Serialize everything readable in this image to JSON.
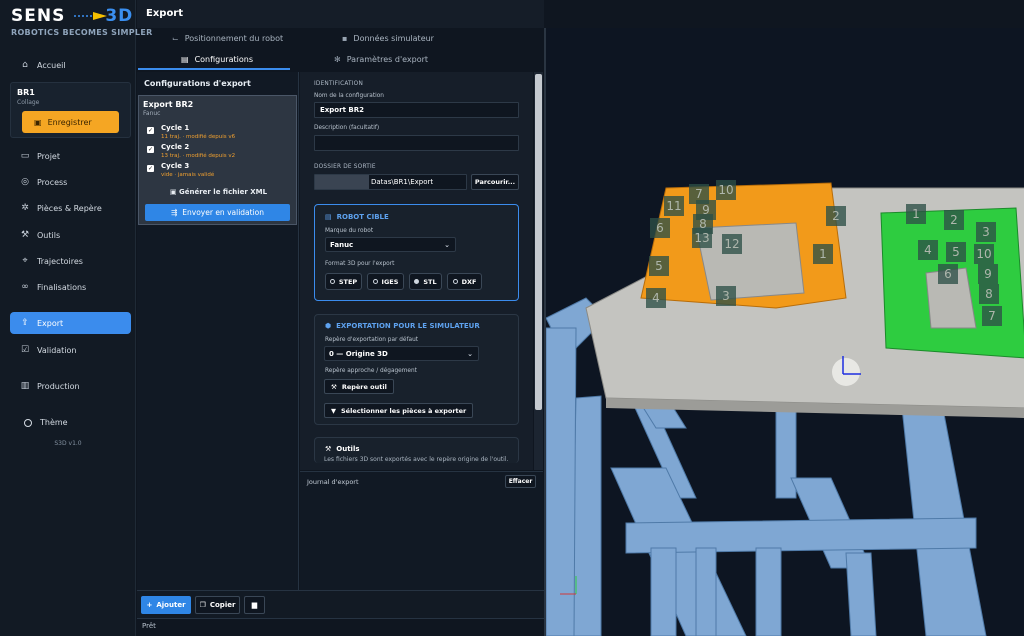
{
  "brand": {
    "word": "SENS",
    "accent": "3D",
    "tagline": "ROBOTICS BECOMES SIMPLER"
  },
  "nav": {
    "home": "Accueil",
    "project_box": {
      "name": "BR1",
      "sub": "Collage",
      "save_label": "Enregistrer"
    },
    "items": [
      {
        "label": "Projet",
        "icon": "folder-icon"
      },
      {
        "label": "Process",
        "icon": "target-icon"
      },
      {
        "label": "Pièces & Repère",
        "icon": "gear-icon"
      },
      {
        "label": "Outils",
        "icon": "wrench-icon"
      },
      {
        "label": "Trajectoires",
        "icon": "location-pin-icon"
      },
      {
        "label": "Finalisations",
        "icon": "link-icon"
      },
      {
        "label": "Export",
        "icon": "export-icon",
        "active": true
      },
      {
        "label": "Validation",
        "icon": "checkbox-icon"
      },
      {
        "label": "Production",
        "icon": "factory-icon"
      }
    ],
    "theme": "Thème",
    "version": "S3D v1.0"
  },
  "header": {
    "title": "Export"
  },
  "tabs": {
    "positioning": "Positionnement du robot",
    "sim_data": "Données simulateur",
    "configs": "Configurations",
    "export_params": "Paramètres d'export"
  },
  "configs_panel": {
    "title": "Configurations d'export",
    "card": {
      "name": "Export BR2",
      "brand": "Fanuc",
      "cycles": [
        {
          "name": "Cycle 1",
          "status": "11 traj. · modifié depuis v6",
          "checked": true
        },
        {
          "name": "Cycle 2",
          "status": "13 traj. · modifié depuis v2",
          "checked": true
        },
        {
          "name": "Cycle 3",
          "status": "vide · jamais validé",
          "checked": true
        }
      ],
      "generate_xml": "Générer le fichier XML",
      "send_validation": "Envoyer en validation"
    }
  },
  "form": {
    "identification_label": "IDENTIFICATION",
    "config_name_label": "Nom de la configuration",
    "config_name_value": "Export BR2",
    "description_label": "Description (facultatif)",
    "description_value": "",
    "output_dir_label": "DOSSIER DE SORTIE",
    "output_dir_value": "Datas\\BR1\\Export",
    "browse_label": "Parcourir...",
    "robot": {
      "title": "ROBOT CIBLE",
      "brand_label": "Marque du robot",
      "brand_value": "Fanuc",
      "format_label": "Format 3D pour l'export",
      "formats": [
        {
          "label": "STEP",
          "selected": false
        },
        {
          "label": "IGES",
          "selected": false
        },
        {
          "label": "STL",
          "selected": true
        },
        {
          "label": "DXF",
          "selected": false
        }
      ]
    },
    "simulator": {
      "title": "EXPORTATION POUR LE SIMULATEUR",
      "frame_label": "Repère d'exportation par défaut",
      "frame_value": "0 — Origine 3D",
      "approach_label": "Repère approche / dégagement",
      "tool_frame_button": "Repère outil",
      "select_parts_button": "Sélectionner les pièces à exporter"
    },
    "tools": {
      "title": "Outils",
      "desc": "Les fichiers 3D sont exportés avec le repère origine de l'outil."
    }
  },
  "journal": {
    "label": "Journal d'export",
    "clear": "Effacer"
  },
  "bottom": {
    "add": "Ajouter",
    "copy": "Copier"
  },
  "status": "Prêt",
  "viewport": {
    "orange_labels": [
      "10",
      "7",
      "11",
      "9",
      "8",
      "6",
      "13",
      "12",
      "2",
      "5",
      "1",
      "4",
      "3"
    ],
    "green_labels": [
      "1",
      "2",
      "3",
      "4",
      "5",
      "10",
      "6",
      "9",
      "8",
      "7"
    ]
  },
  "colors": {
    "accent": "#3b8ced",
    "save": "#f5a623",
    "warning": "#f0a030",
    "orange_part": "#f29a1a",
    "green_part": "#2ecc40"
  }
}
